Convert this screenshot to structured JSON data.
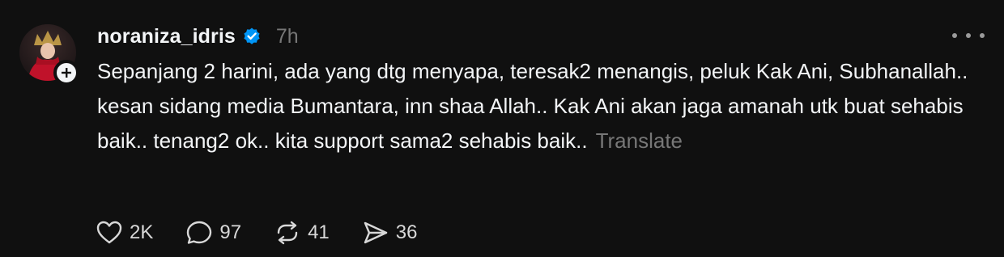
{
  "post": {
    "username": "noraniza_idris",
    "verified": true,
    "timestamp": "7h",
    "text": "Sepanjang 2 harini, ada yang dtg menyapa, teresak2 menangis, peluk Kak Ani, Subhanallah.. kesan sidang media Bumantara, inn shaa Allah.. Kak Ani akan jaga amanah utk buat sehabis baik.. tenang2 ok.. kita support sama2 sehabis baik..",
    "translate_label": "Translate",
    "actions": {
      "likes": "2K",
      "replies": "97",
      "reposts": "41",
      "shares": "36"
    }
  },
  "colors": {
    "background": "#101010",
    "text_primary": "#f3f5f7",
    "text_secondary": "#777777",
    "verified_blue": "#0095f6"
  },
  "icons": [
    "avatar",
    "plus-icon",
    "verified-badge-icon",
    "more-options-icon",
    "heart-icon",
    "comment-icon",
    "repost-icon",
    "share-icon"
  ]
}
